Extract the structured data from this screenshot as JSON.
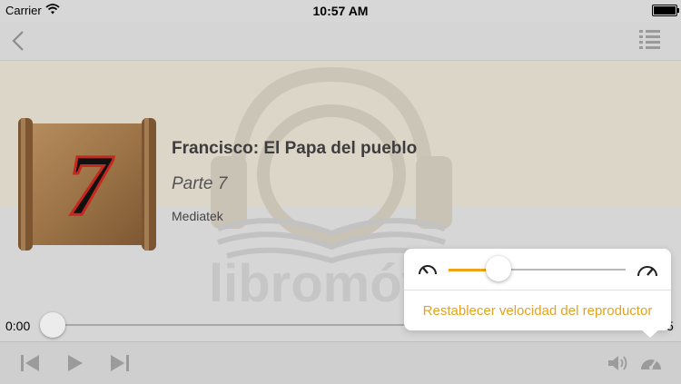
{
  "status_bar": {
    "carrier": "Carrier",
    "time": "10:57 AM"
  },
  "book": {
    "title": "Francisco: El Papa del pueblo",
    "part": "Parte 7",
    "publisher": "Mediatek",
    "cover_number": "7"
  },
  "watermark": {
    "brand_text": "libromóvil"
  },
  "player": {
    "elapsed": "0:00",
    "remaining_partial": "5",
    "progress": 0
  },
  "speed_popover": {
    "reset_label": "Restablecer velocidad del reproductor",
    "speed_level": 0.28,
    "slow_icon": "slow-speed-gauge-icon",
    "fast_icon": "fast-speed-gauge-icon"
  },
  "toolbar_icons": [
    "previous-icon",
    "play-icon",
    "next-icon",
    "volume-icon",
    "speedometer-icon"
  ],
  "colors": {
    "accent": "#f0a21b",
    "accent_text": "#e3a21f",
    "overlay": "#d6d6d6"
  }
}
